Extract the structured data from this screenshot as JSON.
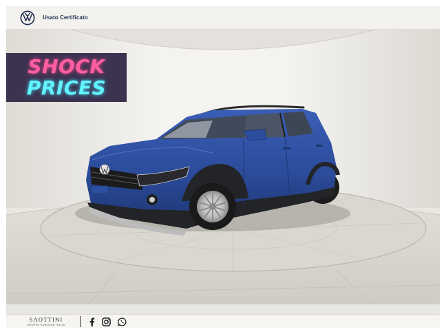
{
  "header": {
    "brand_logo": "volkswagen-logo-icon",
    "label": "Usato Certificato"
  },
  "banner": {
    "line1": "SHOCK",
    "line2": "PRICES",
    "line1_color": "#ff5fa0",
    "line2_color": "#62f4ff",
    "background": "#3b3350"
  },
  "photo": {
    "subject": "car-photo",
    "car_color": "#2b4c9a"
  },
  "footer": {
    "dealer_name": "SAOTTINI",
    "dealer_group": "GRUPPO EUROCAR ITALIA",
    "social_icons": [
      "facebook-icon",
      "instagram-icon",
      "whatsapp-icon"
    ]
  }
}
